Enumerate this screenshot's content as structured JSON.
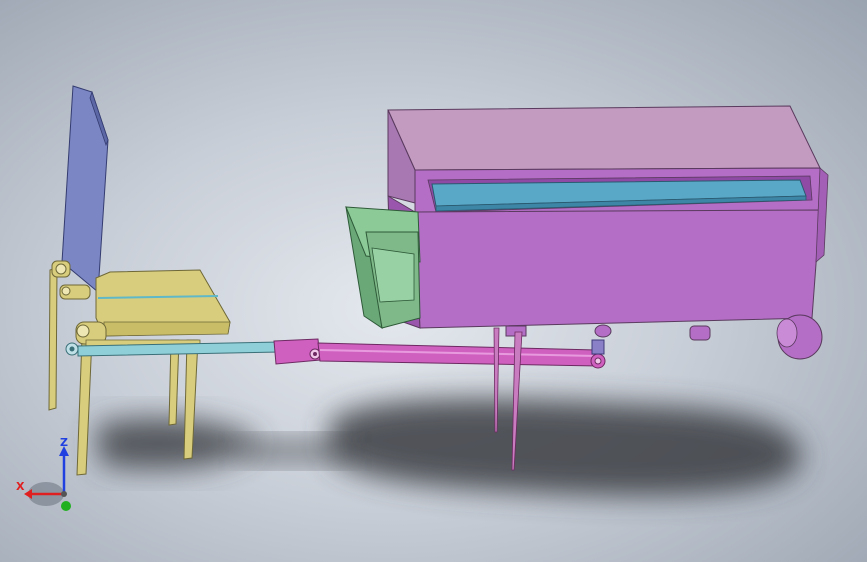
{
  "axes": {
    "x_label": "X",
    "z_label": "Z"
  },
  "colors": {
    "background_center": "#e4e8ee",
    "background_edge": "#9aa3b0",
    "chair_frame": "#d8cd7c",
    "chair_back": "#7b86c4",
    "linkage_bar": "#8fd0d8",
    "actuator": "#d060c0",
    "cabinet": "#b46ec6",
    "cabinet_top": "#c39ac0",
    "tray": "#5aa8c8",
    "drawer": "#7fb889",
    "axis_x": "#e02020",
    "axis_y": "#20b020",
    "axis_z": "#2040e0"
  }
}
